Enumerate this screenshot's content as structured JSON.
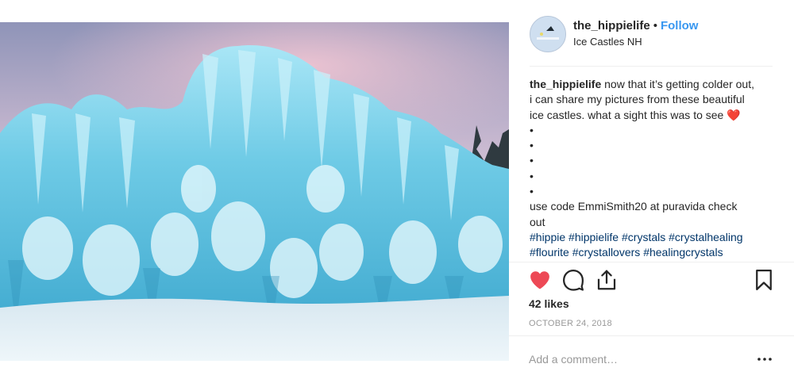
{
  "post": {
    "username": "the_hippielife",
    "separator": "•",
    "follow_label": "Follow",
    "location": "Ice Castles NH",
    "caption_lines": [
      "now that it’s getting colder out,",
      "i can share my pictures from these beautiful",
      "ice castles. what a sight this was to see",
      "•",
      "•",
      "•",
      "•",
      "•",
      "use code EmmiSmith20 at puravida check",
      "out"
    ],
    "caption_emoji": "❤️",
    "hashtags_line1": [
      "#hippie",
      "#hippielife",
      "#crystals",
      "#crystalhealing"
    ],
    "hashtags_line2": [
      "#flourite",
      "#crystallovers",
      "#healingcrystals"
    ],
    "likes": "42 likes",
    "date": "OCTOBER 24, 2018",
    "comment_placeholder": "Add a comment…",
    "liked": true
  },
  "colors": {
    "link_blue": "#3897f0",
    "hashtag_blue": "#003569",
    "like_red": "#ed4956",
    "muted_gray": "#999999"
  },
  "icons": [
    "heart-icon",
    "comment-icon",
    "share-icon",
    "bookmark-icon",
    "more-options-icon"
  ]
}
